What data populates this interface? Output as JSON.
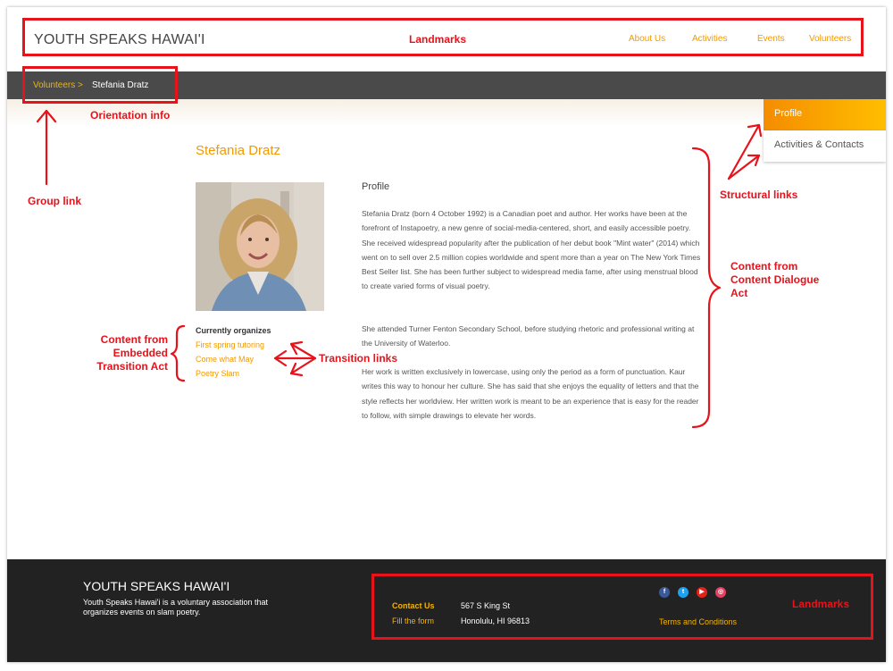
{
  "header": {
    "brand": "YOUTH SPEAKS HAWAI'I",
    "nav": [
      "About Us",
      "Activities",
      "Events",
      "Volunteers"
    ]
  },
  "breadcrumb": {
    "parent": "Volunteers >",
    "current": "Stefania Dratz"
  },
  "side_nav": {
    "profile": "Profile",
    "activities": "Activities & Contacts"
  },
  "person": {
    "name": "Stefania Dratz"
  },
  "organizes": {
    "title": "Currently organizes",
    "items": [
      "First spring tutoring",
      "Come what May",
      "Poetry Slam"
    ]
  },
  "profile": {
    "heading": "Profile",
    "paragraphs": [
      "Stefania Dratz (born 4 October 1992) is a Canadian poet and author. Her works have been at the forefront of Instapoetry, a new genre of social-media-centered, short, and easily accessible poetry. She received widespread popularity after the publication of her debut book \"Mint water\" (2014) which went on to sell over 2.5 million copies worldwide and spent more than a year on The New York Times Best Seller list. She has been further subject to widespread media fame, after using menstrual blood to create varied forms of visual poetry.",
      "She attended Turner Fenton Secondary School, before studying rhetoric and professional writing at the University of Waterloo.",
      "Her work is written exclusively in lowercase, using only the period as a form of punctuation. Kaur writes this way to honour her culture. She has said that she enjoys the equality of letters and that the style reflects her worldview. Her written work is meant to be an experience that is easy for the reader to follow, with simple drawings to elevate her words."
    ]
  },
  "footer": {
    "brand": "YOUTH SPEAKS HAWAI'I",
    "description": "Youth Speaks Hawai'i is a voluntary association that organizes events on slam poetry.",
    "contact_label": "Contact Us",
    "form_label": "Fill the form",
    "address_line1": "567 S King St",
    "address_line2": "Honolulu, HI 96813",
    "terms": "Terms and Conditions",
    "social_icons": [
      "facebook-icon",
      "twitter-icon",
      "youtube-icon",
      "instagram-icon"
    ],
    "social_glyphs": [
      "f",
      "t",
      "▶",
      "◎"
    ]
  },
  "annotations": {
    "landmarks_top": "Landmarks",
    "orientation": "Orientation info",
    "group_link": "Group link",
    "structural_links": "Structural links",
    "content_dialogue": "Content from Content Dialogue Act",
    "content_embedded": "Content from Embedded Transition Act",
    "transition_links": "Transition links",
    "landmarks_footer": "Landmarks"
  },
  "colors": {
    "accent": "#f29900",
    "annotation": "#e8121b",
    "breadcrumb_bar": "#4a4a4a",
    "footer_bg": "#222222"
  }
}
